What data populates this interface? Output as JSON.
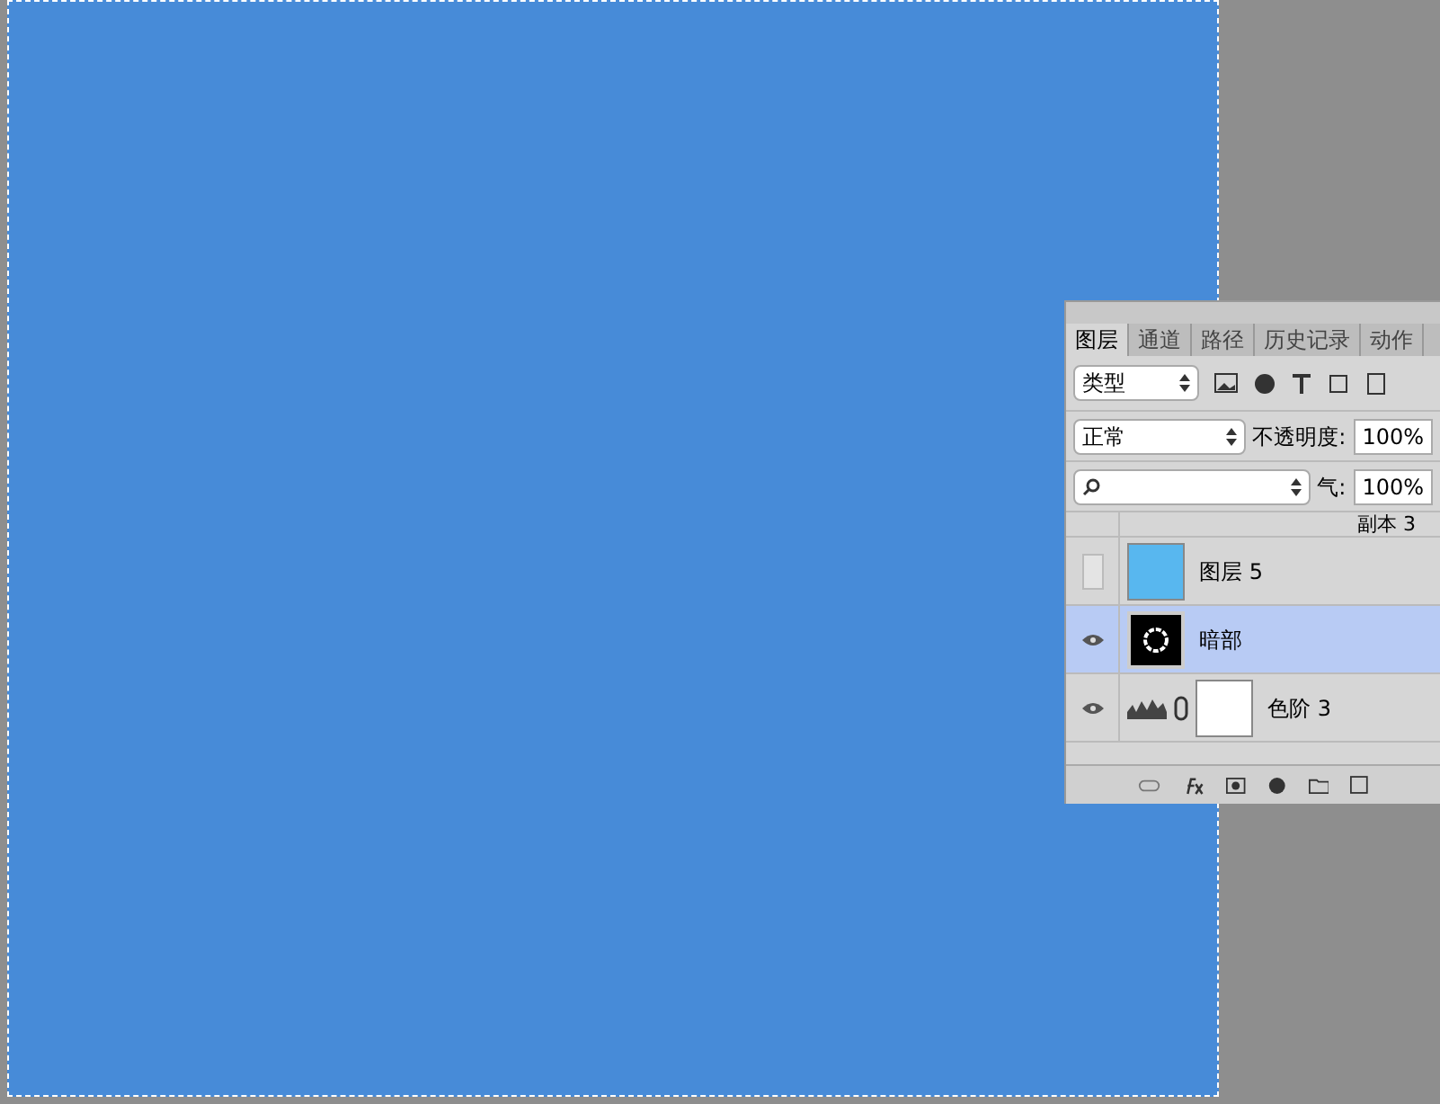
{
  "tabs": [
    {
      "label": "图层",
      "selected": true
    },
    {
      "label": "通道",
      "selected": false
    },
    {
      "label": "路径",
      "selected": false
    },
    {
      "label": "历史记录",
      "selected": false
    },
    {
      "label": "动作",
      "selected": false
    }
  ],
  "filter": {
    "value": "类型"
  },
  "blend_mode": {
    "value": "正常"
  },
  "opacity": {
    "label": "不透明度:",
    "value": "100%"
  },
  "fill": {
    "label": "气:",
    "value": "100%"
  },
  "layers": [
    {
      "name": "副本 3",
      "kind": "partial",
      "visible": false,
      "selected": false
    },
    {
      "name": "图层 5",
      "kind": "pixel",
      "visible": false,
      "selected": false
    },
    {
      "name": "暗部",
      "kind": "mask",
      "visible": true,
      "selected": true
    },
    {
      "name": "色阶 3",
      "kind": "adjustment",
      "visible": true,
      "selected": false
    }
  ]
}
